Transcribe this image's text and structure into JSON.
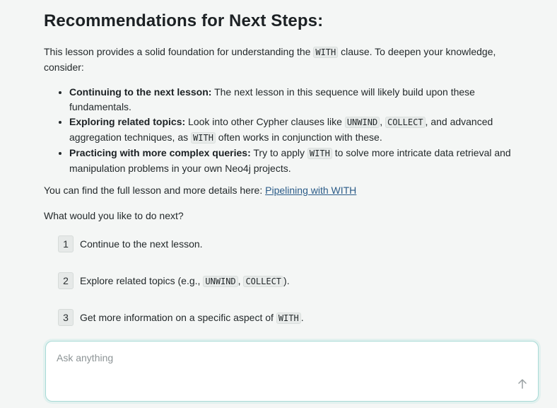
{
  "heading": "Recommendations for Next Steps:",
  "intro": {
    "before": "This lesson provides a solid foundation for understanding the ",
    "code": "WITH",
    "after": " clause. To deepen your knowledge, consider:"
  },
  "bullets": [
    {
      "title": "Continuing to the next lesson:",
      "text": " The next lesson in this sequence will likely build upon these fundamentals."
    },
    {
      "title": "Exploring related topics:",
      "text_a": " Look into other Cypher clauses like ",
      "code_a": "UNWIND",
      "text_b": ", ",
      "code_b": "COLLECT",
      "text_c": ", and advanced aggregation techniques, as ",
      "code_c": "WITH",
      "text_d": " often works in conjunction with these."
    },
    {
      "title": "Practicing with more complex queries:",
      "text_a": " Try to apply ",
      "code_a": "WITH",
      "text_b": " to solve more intricate data retrieval and manipulation problems in your own Neo4j projects."
    }
  ],
  "lesson_line": {
    "text": "You can find the full lesson and more details here: ",
    "link": "Pipelining with WITH"
  },
  "question": "What would you like to do next?",
  "choices": [
    {
      "num": "1",
      "text": "Continue to the next lesson."
    },
    {
      "num": "2",
      "text_a": "Explore related topics (e.g., ",
      "code_a": "UNWIND",
      "text_b": ", ",
      "code_b": "COLLECT",
      "text_c": ")."
    },
    {
      "num": "3",
      "text_a": "Get more information on a specific aspect of ",
      "code_a": "WITH",
      "text_b": "."
    }
  ],
  "composer": {
    "placeholder": "Ask anything",
    "send_icon": "arrow-up-icon"
  },
  "colors": {
    "background": "#f4f6f5",
    "link": "#2a5b88",
    "composer_border": "#a8dad6"
  }
}
